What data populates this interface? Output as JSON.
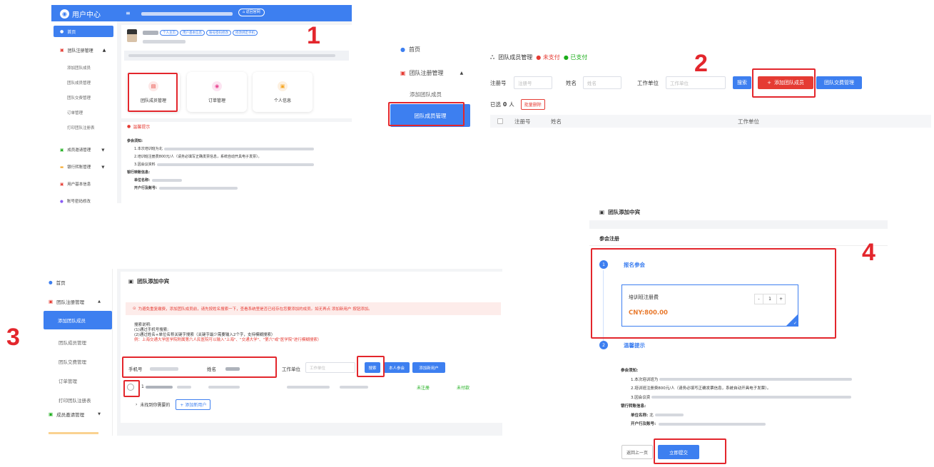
{
  "steps": {
    "s1": "1",
    "s2": "2",
    "s3": "3",
    "s4": "4"
  },
  "colors": {
    "primary": "#3d7ff0",
    "danger": "#e53b33",
    "highlight": "#e3262c",
    "success": "#1aad19"
  },
  "panel1": {
    "app_title": "用户中心",
    "topbar_button": "返回官网",
    "sidebar": {
      "home": "首页",
      "team_register": "团队注册管理",
      "sub": [
        "添加团队成员",
        "团队成员管理",
        "团队交费管理",
        "订单管理",
        "打印团队注册表"
      ],
      "others": [
        "成员邀请管理",
        "银行转账管理",
        "用户基本信息",
        "账号密码修改"
      ]
    },
    "profile_chips": [
      "个人主页",
      "用户基本信息",
      "账号密码修改",
      "修改绑定手机"
    ],
    "cards": [
      "团队成员管理",
      "订单管理",
      "个人信息"
    ],
    "notice_title": "温馨提示",
    "notice": {
      "heading": "参会须知:",
      "line1": "1.本次培训班为北",
      "line2": "2.培训班注册费800元/人（请务必填写正确发票信息，系统自动开具电子发票）。",
      "line3": "3.因会议资料",
      "bank_heading": "银行转账信息:",
      "unit_label": "单位名称:",
      "account_label": "开户行及账号:"
    }
  },
  "panel2": {
    "home": "首页",
    "team_register": "团队注册管理",
    "add_member": "添加团队成员",
    "member_manage": "团队成员管理",
    "title": "团队成员管理",
    "status_unpaid": "未支付",
    "status_paid": "已支付",
    "filter": {
      "reg_label": "注册号",
      "reg_placeholder": "注册号",
      "name_label": "姓名",
      "name_placeholder": "姓名",
      "unit_label": "工作单位",
      "unit_placeholder": "工作单位"
    },
    "search_btn": "搜索",
    "add_btn": "添加团队成员",
    "fee_btn": "团队交费管理",
    "selected_prefix": "已选",
    "selected_count": "0",
    "selected_suffix": "人",
    "batch_delete": "批量删除",
    "columns": [
      "注册号",
      "姓名",
      "工作单位"
    ]
  },
  "panel3": {
    "sidebar": {
      "home": "首页",
      "team_register": "团队注册管理",
      "sub": [
        "添加团队成员",
        "团队成员管理",
        "团队交费管理",
        "订单管理",
        "打印团队注册表"
      ],
      "invite": "成员邀请管理"
    },
    "title": "团队添加中宾",
    "warning": "为避免重复缴费，添加团队成员前，请先按姓名搜索一下，查看系统里是否已经存在您要添加的成员。如无再点 添加新用户 按钮添加。",
    "search_desc": {
      "heading": "搜索说明:",
      "line1": "(1)通过手机号搜索;",
      "line2": "(2)通过姓名+单位名称关键字搜索（关键字最少需要输入2个字，支持模糊搜索）",
      "example": "例：上海交通大学医学院附属第六人民医院可以输入\"上海\"、\"交通大学\"、\"第六\"或\"医学院\"进行模糊搜索）"
    },
    "phone_label": "手机号",
    "name_label": "姓名",
    "unit_label": "工作单位",
    "unit_placeholder": "工作单位",
    "search_btn": "搜索",
    "self_btn": "本人参会",
    "new_user_btn": "添加新用户",
    "result_row": {
      "row_prefix": "1",
      "status_reg": "未注册",
      "status_pay": "未付款"
    },
    "not_found": "未找到你需要的",
    "add_new_user": "添加新用户"
  },
  "panel4": {
    "title": "团队添加中宾",
    "section": "参会注册",
    "step1_title": "报名参会",
    "fee_name": "培训班注册费",
    "price": "CNY:800.00",
    "qty": "1",
    "minus": "-",
    "plus": "+",
    "step2_title": "温馨提示",
    "notice": {
      "heading": "参会须知:",
      "line1": "1.本次培训班为",
      "line2": "2.培训班注册费800元/人（请务必填写正确发票信息，系统自动开具电子发票）。",
      "line3": "3.因会议资",
      "bank_heading": "银行转账信息:",
      "unit_label": "单位名称:",
      "unit_value": "北",
      "account_label": "开户行及账号:"
    },
    "back_btn": "返回上一页",
    "submit_btn": "立即提交"
  }
}
